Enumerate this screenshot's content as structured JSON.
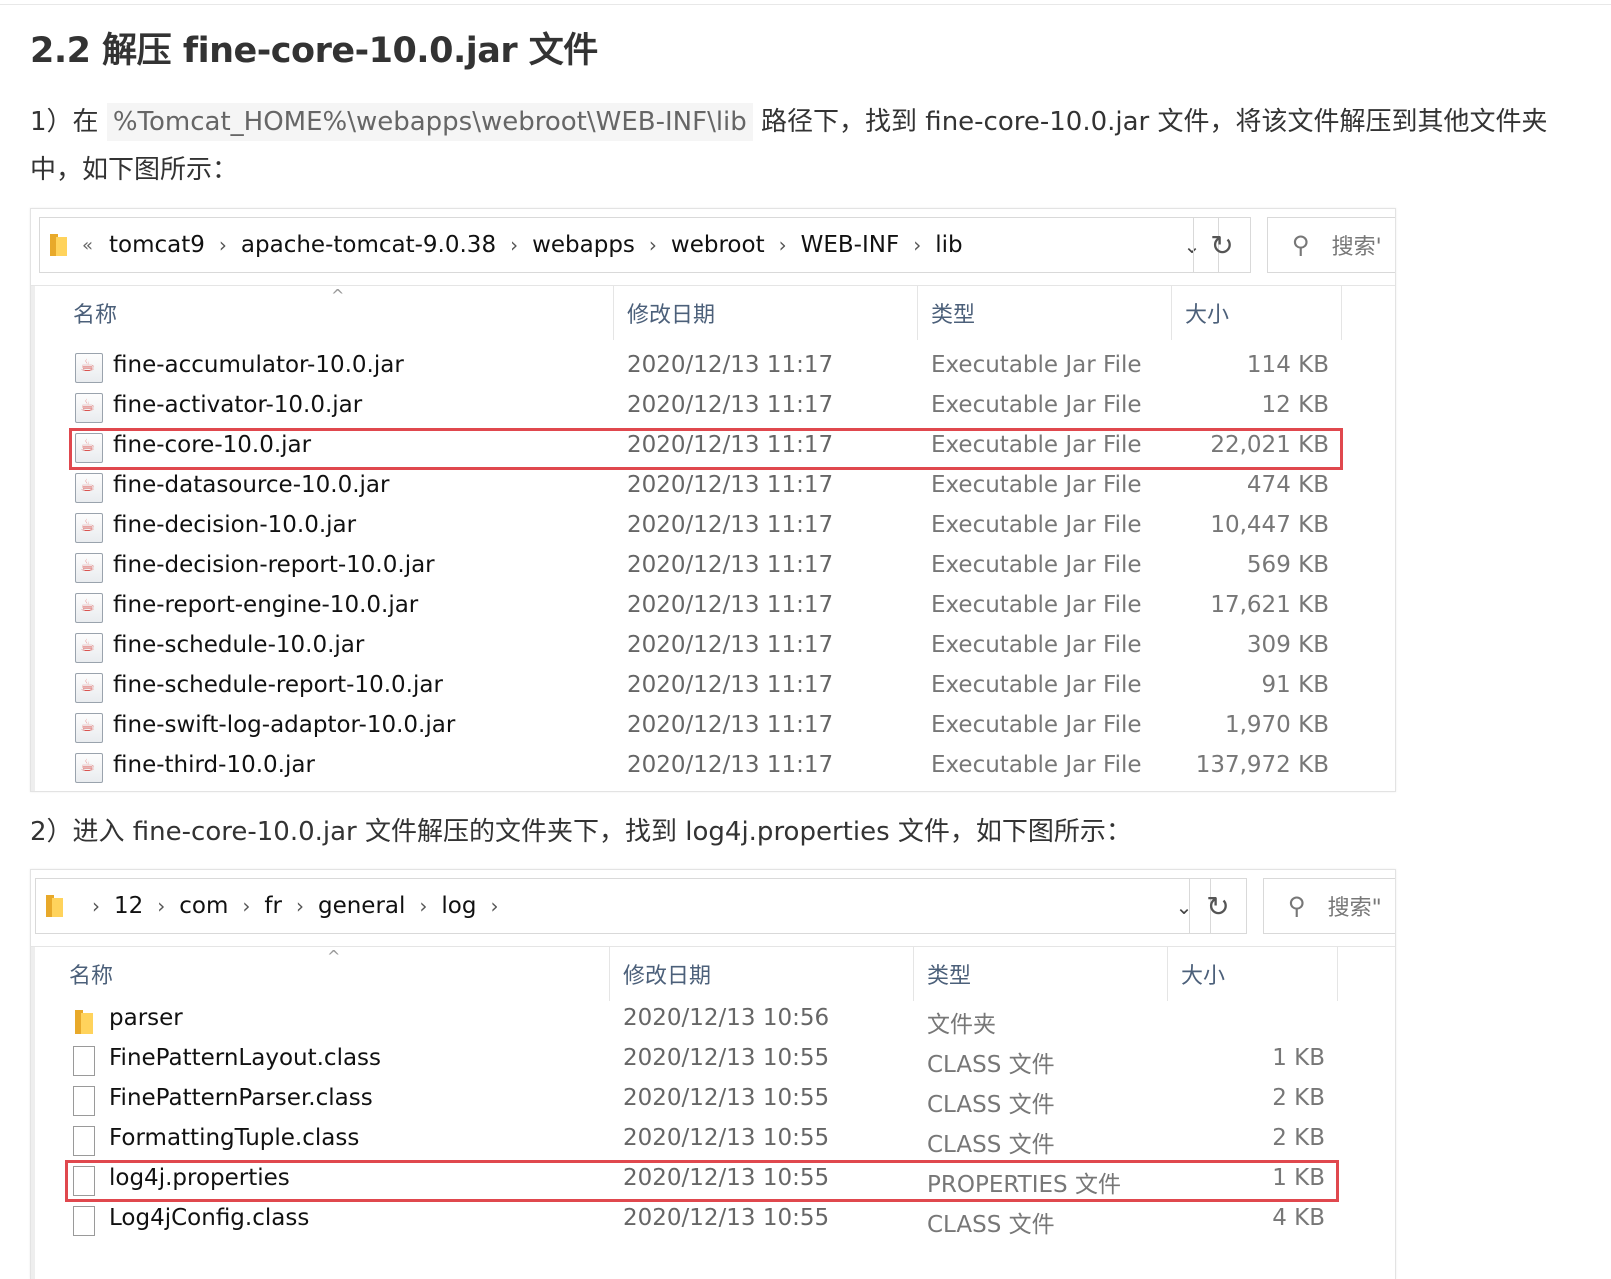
{
  "heading": "2.2 解压 fine-core-10.0.jar 文件",
  "step1": {
    "prefix": "1）在 ",
    "code": "%Tomcat_HOME%\\webapps\\webroot\\WEB-INF\\lib",
    "suffix": " 路径下，找到 fine-core-10.0.jar 文件，将该文件解压到其他文件夹",
    "line2": "中，如下图所示："
  },
  "step2": "2）进入 fine-core-10.0.jar 文件解压的文件夹下，找到 log4j.properties 文件，如下图所示：",
  "explorer1": {
    "breadcrumb_overflow": "«",
    "breadcrumb": [
      "tomcat9",
      "apache-tomcat-9.0.38",
      "webapps",
      "webroot",
      "WEB-INF",
      "lib"
    ],
    "search_placeholder": "搜索'",
    "columns": {
      "name": "名称",
      "date": "修改日期",
      "type": "类型",
      "size": "大小"
    },
    "rows": [
      {
        "name": "fine-accumulator-10.0.jar",
        "date": "2020/12/13 11:17",
        "type": "Executable Jar File",
        "size": "114 KB"
      },
      {
        "name": "fine-activator-10.0.jar",
        "date": "2020/12/13 11:17",
        "type": "Executable Jar File",
        "size": "12 KB"
      },
      {
        "name": "fine-core-10.0.jar",
        "date": "2020/12/13 11:17",
        "type": "Executable Jar File",
        "size": "22,021 KB"
      },
      {
        "name": "fine-datasource-10.0.jar",
        "date": "2020/12/13 11:17",
        "type": "Executable Jar File",
        "size": "474 KB"
      },
      {
        "name": "fine-decision-10.0.jar",
        "date": "2020/12/13 11:17",
        "type": "Executable Jar File",
        "size": "10,447 KB"
      },
      {
        "name": "fine-decision-report-10.0.jar",
        "date": "2020/12/13 11:17",
        "type": "Executable Jar File",
        "size": "569 KB"
      },
      {
        "name": "fine-report-engine-10.0.jar",
        "date": "2020/12/13 11:17",
        "type": "Executable Jar File",
        "size": "17,621 KB"
      },
      {
        "name": "fine-schedule-10.0.jar",
        "date": "2020/12/13 11:17",
        "type": "Executable Jar File",
        "size": "309 KB"
      },
      {
        "name": "fine-schedule-report-10.0.jar",
        "date": "2020/12/13 11:17",
        "type": "Executable Jar File",
        "size": "91 KB"
      },
      {
        "name": "fine-swift-log-adaptor-10.0.jar",
        "date": "2020/12/13 11:17",
        "type": "Executable Jar File",
        "size": "1,970 KB"
      },
      {
        "name": "fine-third-10.0.jar",
        "date": "2020/12/13 11:17",
        "type": "Executable Jar File",
        "size": "137,972 KB"
      }
    ]
  },
  "explorer2": {
    "breadcrumb": [
      "12",
      "com",
      "fr",
      "general",
      "log"
    ],
    "search_placeholder": "搜索\"",
    "columns": {
      "name": "名称",
      "date": "修改日期",
      "type": "类型",
      "size": "大小"
    },
    "rows": [
      {
        "name": "parser",
        "date": "2020/12/13 10:56",
        "type": "文件夹",
        "size": "",
        "icon": "folder"
      },
      {
        "name": "FinePatternLayout.class",
        "date": "2020/12/13 10:55",
        "type": "CLASS 文件",
        "size": "1 KB",
        "icon": "file"
      },
      {
        "name": "FinePatternParser.class",
        "date": "2020/12/13 10:55",
        "type": "CLASS 文件",
        "size": "2 KB",
        "icon": "file"
      },
      {
        "name": "FormattingTuple.class",
        "date": "2020/12/13 10:55",
        "type": "CLASS 文件",
        "size": "2 KB",
        "icon": "file"
      },
      {
        "name": "log4j.properties",
        "date": "2020/12/13 10:55",
        "type": "PROPERTIES 文件",
        "size": "1 KB",
        "icon": "file"
      },
      {
        "name": "Log4jConfig.class",
        "date": "2020/12/13 10:55",
        "type": "CLASS 文件",
        "size": "4 KB",
        "icon": "file"
      }
    ]
  }
}
